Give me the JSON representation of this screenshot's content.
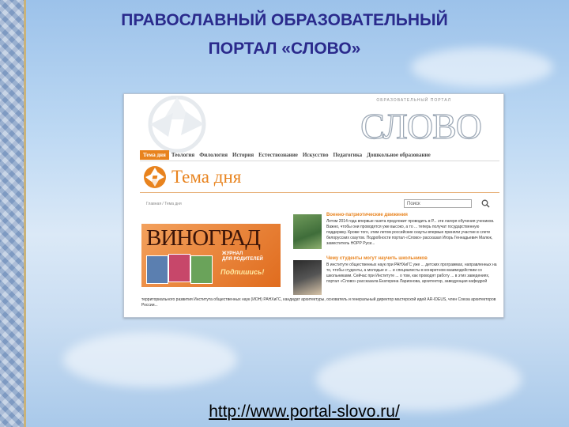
{
  "slide": {
    "title_line1": "ПРАВОСЛАВНЫЙ ОБРАЗОВАТЕЛЬНЫЙ",
    "title_line2": "ПОРТАЛ «СЛОВО»",
    "link": "http://www.portal-slovo.ru/"
  },
  "site": {
    "label": "ОБРАЗОВАТЕЛЬНЫЙ ПОРТАЛ",
    "logo": "СЛОВО",
    "nav": [
      "Тема дня",
      "Теология",
      "Филология",
      "История",
      "Естествознание",
      "Искусство",
      "Педагогика",
      "Дошкольное образование"
    ],
    "section_title": "Тема дня",
    "breadcrumb": "Главная / Тема дня",
    "search_placeholder": "Поиск",
    "magazine": {
      "name": "ВИНОГРАД",
      "subtitle1": "ЖУРНАЛ",
      "subtitle2": "ДЛЯ РОДИТЕЛЕЙ",
      "cta": "Подпишись!"
    },
    "news": [
      {
        "title": "Военно-патриотические движения",
        "text": "Летом 2014 года впервые газета предложит проводить в Р... эти лагеря обучения учеников. Важно, чтобы они проводятся уже высоко, а то ... теперь получат государственную поддержку. Кроме того, этим летом российские скауты впервые приняли участие в слете белорусских скаутов. Подробности портал «Слово» рассказал Игорь Геннадьевич Малюк, заместитель НОРР Руси..."
      },
      {
        "title": "Чему студенты могут научить школьников",
        "text": "В институте общественных наук при РАНХиГС уже ... детских программах, направленных на то, чтобы студенты, а молодые и ... и специалисты в конкретном взаимодействии со школьниками. Сейчас при Институте ... о том, как проводят работу ... в этих заведениях, портал «Слово» рассказала Екатерина Ларионова, архитектор, заведующая кафедрой"
      }
    ],
    "bottom_text": "территориального развития Института общественных наук (ИОН) РАНХиГС, кандидат архитектуры, основатель и генеральный директор мастерской идей AR-IDEUS, член Союза архитекторов России..."
  },
  "colors": {
    "accent": "#e8831e",
    "title": "#2a2a8c"
  }
}
